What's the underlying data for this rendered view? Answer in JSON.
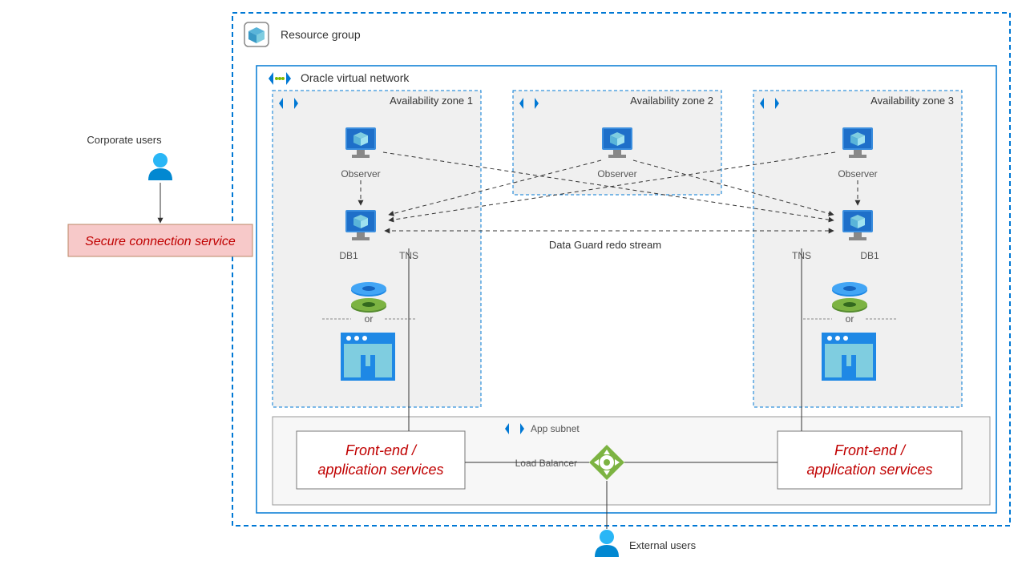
{
  "outer": {
    "resource_group": "Resource group",
    "vnet": "Oracle virtual network"
  },
  "zones": {
    "z1": "Availability zone 1",
    "z2": "Availability zone 2",
    "z3": "Availability zone 3"
  },
  "labels": {
    "observer": "Observer",
    "db1": "DB1",
    "tns": "TNS",
    "or": "or",
    "app_subnet": "App subnet",
    "load_balancer": "Load Balancer",
    "data_guard": "Data Guard redo stream",
    "corporate_users": "Corporate users",
    "external_users": "External users",
    "secure_service": "Secure connection service",
    "frontend1": "Front-end /",
    "frontend2": "application  services"
  }
}
